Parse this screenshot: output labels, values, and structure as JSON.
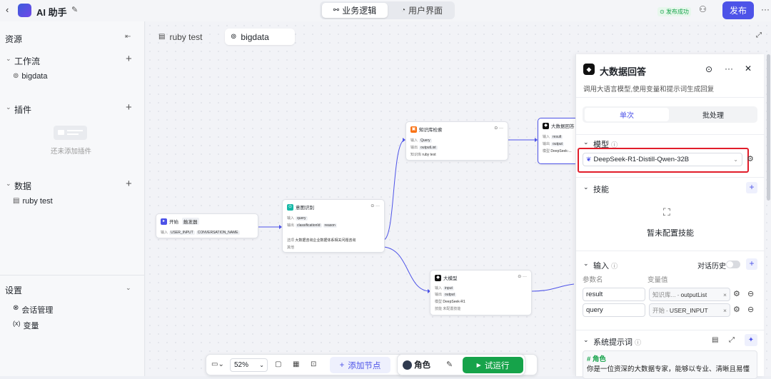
{
  "header": {
    "back_icon": "chevron-left-icon",
    "title": "AI 助手",
    "tabs": [
      {
        "label": "业务逻辑",
        "active": true
      },
      {
        "label": "用户界面",
        "active": false
      }
    ],
    "publish_status": "发布成功",
    "publish_button": "发布",
    "more": "···"
  },
  "sidebar": {
    "resources": "资源",
    "workflow": {
      "label": "工作流",
      "items": [
        "bigdata"
      ]
    },
    "plugins": {
      "label": "插件",
      "empty": "还未添加插件"
    },
    "data": {
      "label": "数据",
      "items": [
        "ruby test"
      ]
    },
    "settings": {
      "label": "设置",
      "items": [
        "会话管理",
        "变量"
      ]
    }
  },
  "canvas": {
    "tabs": [
      {
        "label": "ruby test",
        "active": false
      },
      {
        "label": "bigdata",
        "active": true
      }
    ],
    "nodes": {
      "start": {
        "title": "开始",
        "badge": "触发器",
        "in_label": "输入",
        "params": [
          "USER_INPUT",
          "CONVERSATION_NAME"
        ]
      },
      "intent": {
        "title": "意图识别",
        "in_label": "输入",
        "input": "query",
        "out_label": "输出",
        "outputs": [
          "classificationId",
          "reason"
        ],
        "option_label": "选项",
        "option": "大数据咨询企业数据体系相关问题咨询",
        "other": "其他"
      },
      "kb": {
        "title": "知识库检索",
        "in_label": "输入",
        "input": "Query",
        "out_label": "输出",
        "output": "outputList",
        "kb_label": "知识库",
        "kb": "ruby test"
      },
      "bigdata_answer": {
        "title": "大数据回答",
        "in_label": "输入",
        "input": "result",
        "out_label": "输出",
        "output": "output",
        "model_label": "模型",
        "model": "DeepSeek-..."
      },
      "llm": {
        "title": "大模型",
        "in_label": "输入",
        "input": "input",
        "out_label": "输出",
        "output": "output",
        "model_label": "模型",
        "model": "DeepSeek-R1",
        "skill_label": "技能",
        "skill": "未配置技能"
      }
    }
  },
  "panel": {
    "title": "大数据回答",
    "description": "调用大语言模型,使用变量和提示词生成回复",
    "modes": [
      "单次",
      "批处理"
    ],
    "model": {
      "label": "模型",
      "value": "DeepSeek-R1-Distill-Qwen-32B"
    },
    "skills": {
      "label": "技能",
      "empty": "暂未配置技能"
    },
    "input": {
      "label": "输入",
      "history": "对话历史",
      "col_name": "参数名",
      "col_value": "变量值",
      "rows": [
        {
          "name": "result",
          "source": "知识库...",
          "value": "outputList"
        },
        {
          "name": "query",
          "source": "开始",
          "value": "USER_INPUT"
        }
      ]
    },
    "prompt": {
      "label": "系统提示词",
      "heading": "# 角色",
      "text": "你是一位资深的大数据专家，能够以专业、清晰且易懂"
    }
  },
  "toolbar": {
    "zoom": "52%",
    "add_node": "添加节点",
    "role": "角色",
    "run": "试运行"
  },
  "colors": {
    "accent": "#4d53e8",
    "run": "#16a34a",
    "highlight": "#e11d2a"
  }
}
